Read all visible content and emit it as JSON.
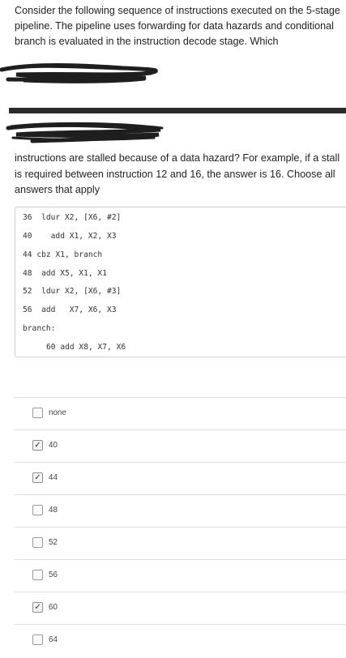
{
  "question": {
    "text_part1": "Consider the following sequence of instructions executed on the 5-stage pipeline.  The pipeline uses forwarding for data hazards and conditional branch is evaluated in the instruction decode stage.  Which",
    "text_part2": "instructions are stalled because of a data hazard? For example, if a stall is required between instruction 12 and 16, the answer is 16. Choose all answers that apply"
  },
  "code": {
    "lines": [
      "36  ldur X2, [X6, #2]",
      "40    add X1, X2, X3",
      "44 cbz X1, branch",
      "48  add X5, X1, X1",
      "52  ldur X2, [X6, #3]",
      "56  add   X7, X6, X3",
      "branch:",
      "60 add X8, X7, X6"
    ]
  },
  "options": [
    {
      "label": "none",
      "checked": false
    },
    {
      "label": "40",
      "checked": true
    },
    {
      "label": "44",
      "checked": true
    },
    {
      "label": "48",
      "checked": false
    },
    {
      "label": "52",
      "checked": false
    },
    {
      "label": "56",
      "checked": false
    },
    {
      "label": "60",
      "checked": true
    },
    {
      "label": "64",
      "checked": false
    }
  ]
}
